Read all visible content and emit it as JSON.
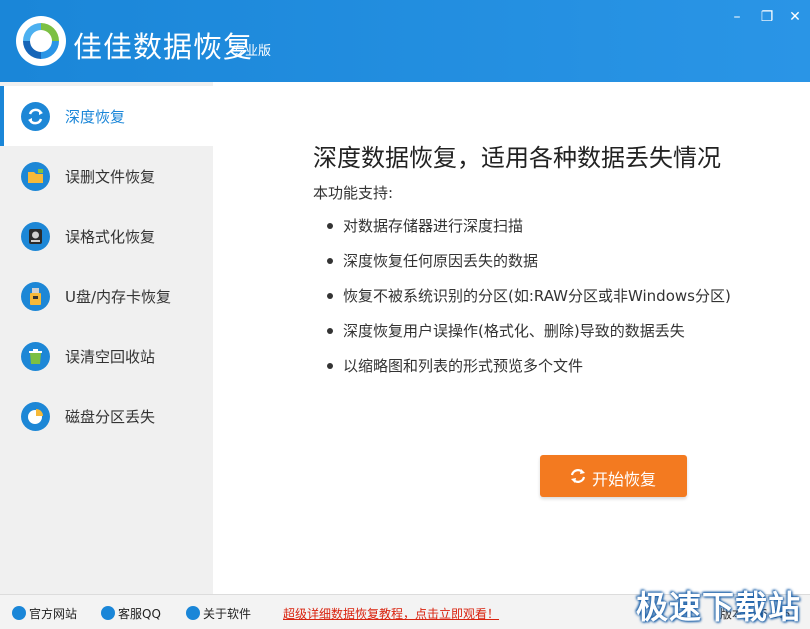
{
  "app": {
    "title": "佳佳数据恢复",
    "edition": "专业版"
  },
  "window_controls": {
    "minimize": "–",
    "maximize": "❐",
    "close": "✕"
  },
  "sidebar": {
    "items": [
      {
        "label": "深度恢复",
        "icon": "refresh-icon",
        "active": true
      },
      {
        "label": "误删文件恢复",
        "icon": "folder-icon",
        "active": false
      },
      {
        "label": "误格式化恢复",
        "icon": "disk-icon",
        "active": false
      },
      {
        "label": "U盘/内存卡恢复",
        "icon": "usb-icon",
        "active": false
      },
      {
        "label": "误清空回收站",
        "icon": "recycle-bin-icon",
        "active": false
      },
      {
        "label": "磁盘分区丢失",
        "icon": "pie-chart-icon",
        "active": false
      }
    ]
  },
  "main": {
    "heading": "深度数据恢复，适用各种数据丢失情况",
    "subtitle": "本功能支持:",
    "features": [
      "对数据存储器进行深度扫描",
      "深度恢复任何原因丢失的数据",
      "恢复不被系统识别的分区(如:RAW分区或非Windows分区)",
      "深度恢复用户误操作(格式化、删除)导致的数据丢失",
      "以缩略图和列表的形式预览多个文件"
    ],
    "start_button": "开始恢复"
  },
  "statusbar": {
    "official_site": "官方网站",
    "support_qq": "客服QQ",
    "about": "关于软件",
    "promo": "超级详细数据恢复教程，点击立即观看！",
    "version": "版本: V6.3.5"
  },
  "watermark": "极速下载站",
  "colors": {
    "accent": "#1a86d8",
    "start_button": "#f37a20",
    "promo": "#d9230f"
  }
}
